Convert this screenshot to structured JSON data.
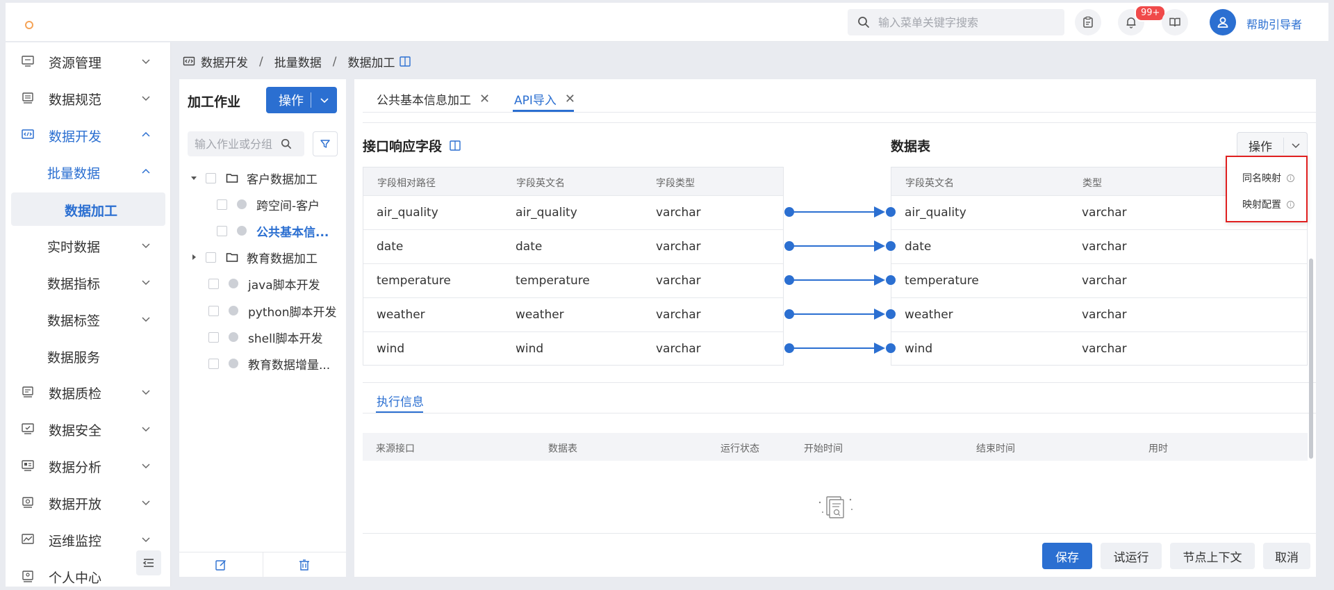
{
  "header": {
    "search_placeholder": "输入菜单关键字搜索",
    "notification_count": "99+",
    "user_name": "帮助引导者"
  },
  "sidebar": {
    "items": [
      {
        "label": "资源管理",
        "icon": "monitor-icon"
      },
      {
        "label": "数据规范",
        "icon": "server-icon"
      },
      {
        "label": "数据开发",
        "icon": "code-icon"
      },
      {
        "label": "批量数据"
      },
      {
        "label": "数据加工"
      },
      {
        "label": "实时数据"
      },
      {
        "label": "数据指标"
      },
      {
        "label": "数据标签"
      },
      {
        "label": "数据服务"
      },
      {
        "label": "数据质检",
        "icon": "document-icon"
      },
      {
        "label": "数据安全",
        "icon": "shield-check-icon"
      },
      {
        "label": "数据分析",
        "icon": "analytics-icon"
      },
      {
        "label": "数据开放",
        "icon": "open-icon"
      },
      {
        "label": "运维监控",
        "icon": "chart-line-icon"
      },
      {
        "label": "个人中心",
        "icon": "user-card-icon"
      }
    ]
  },
  "breadcrumb": {
    "items": [
      "数据开发",
      "批量数据",
      "数据加工"
    ]
  },
  "tree": {
    "title": "加工作业",
    "op_label": "操作",
    "search_placeholder": "输入作业或分组",
    "nodes": [
      {
        "label": "客户数据加工",
        "type": "folder",
        "expanded": true
      },
      {
        "label": "跨空间-客户",
        "type": "job"
      },
      {
        "label": "公共基本信...",
        "type": "job",
        "selected": true
      },
      {
        "label": "教育数据加工",
        "type": "folder",
        "expanded": false
      },
      {
        "label": "java脚本开发",
        "type": "job"
      },
      {
        "label": "python脚本开发",
        "type": "job"
      },
      {
        "label": "shell脚本开发",
        "type": "job"
      },
      {
        "label": "教育数据增量...",
        "type": "job"
      }
    ]
  },
  "tabs": [
    {
      "label": "公共基本信息加工"
    },
    {
      "label": "API导入",
      "active": true
    }
  ],
  "left_table": {
    "title": "接口响应字段",
    "columns": [
      "字段相对路径",
      "字段英文名",
      "字段类型"
    ],
    "rows": [
      [
        "air_quality",
        "air_quality",
        "varchar"
      ],
      [
        "date",
        "date",
        "varchar"
      ],
      [
        "temperature",
        "temperature",
        "varchar"
      ],
      [
        "weather",
        "weather",
        "varchar"
      ],
      [
        "wind",
        "wind",
        "varchar"
      ]
    ]
  },
  "right_table": {
    "title": "数据表",
    "op_label": "操作",
    "columns": [
      "字段英文名",
      "类型"
    ],
    "rows": [
      [
        "air_quality",
        "varchar"
      ],
      [
        "date",
        "varchar"
      ],
      [
        "temperature",
        "varchar"
      ],
      [
        "weather",
        "varchar"
      ],
      [
        "wind",
        "varchar"
      ]
    ]
  },
  "dropdown": {
    "items": [
      "同名映射",
      "映射配置"
    ]
  },
  "exec": {
    "tab_label": "执行信息",
    "columns": [
      "来源接口",
      "数据表",
      "运行状态",
      "开始时间",
      "结束时间",
      "用时"
    ]
  },
  "buttons": {
    "save": "保存",
    "trial": "试运行",
    "context": "节点上下文",
    "cancel": "取消"
  },
  "colors": {
    "primary": "#2b6fd1",
    "highlight_border": "#e02020",
    "badge": "#f04a4a"
  }
}
